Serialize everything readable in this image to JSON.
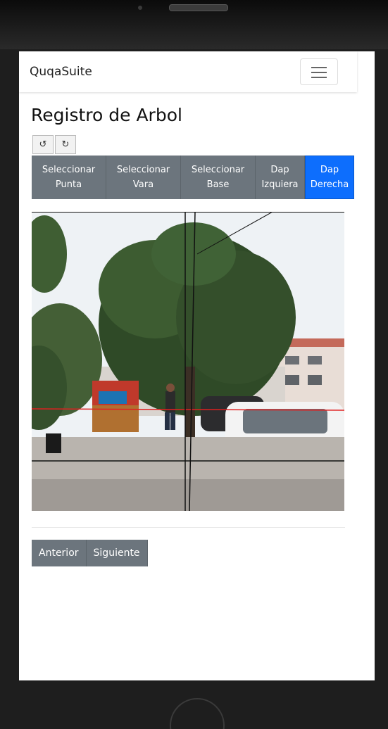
{
  "app": {
    "brand": "QuqaSuite"
  },
  "page": {
    "title": "Registro de Arbol"
  },
  "rotate": {
    "left_icon": "rotate-left-icon",
    "left_glyph": "↺",
    "right_icon": "rotate-right-icon",
    "right_glyph": "↻"
  },
  "toolbar": {
    "items": [
      {
        "line1": "Seleccionar",
        "line2": "Punta"
      },
      {
        "line1": "Seleccionar",
        "line2": "Vara"
      },
      {
        "line1": "Seleccionar",
        "line2": "Base"
      },
      {
        "line1": "Dap",
        "line2": "Izquiera"
      },
      {
        "line1": "Dap",
        "line2": "Derecha"
      }
    ]
  },
  "pager": {
    "prev": "Anterior",
    "next": "Siguiente"
  },
  "colors": {
    "secondary": "#6c757d",
    "primary": "#0d6efd",
    "marker_red": "#e02020",
    "marker_black": "#111111"
  }
}
